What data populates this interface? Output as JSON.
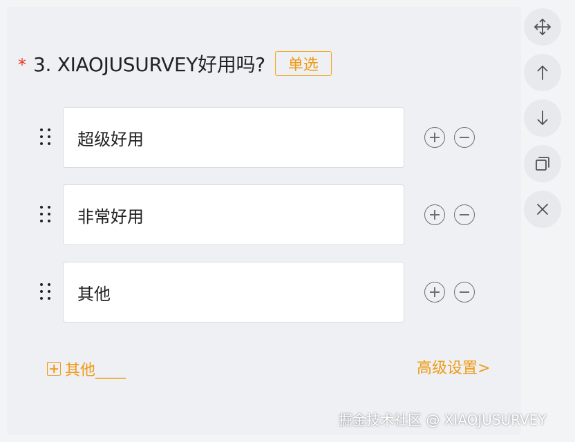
{
  "question": {
    "required_mark": "*",
    "title": "3. XIAOJUSURVEY好用吗?",
    "type_label": "单选"
  },
  "options": [
    {
      "value": "超级好用"
    },
    {
      "value": "非常好用"
    },
    {
      "value": "其他"
    }
  ],
  "footer": {
    "add_other_label": "其他____",
    "advanced_label": "高级设置>"
  },
  "toolbar": {
    "buttons": [
      "move-icon",
      "arrow-up-icon",
      "arrow-down-icon",
      "copy-icon",
      "close-icon"
    ]
  },
  "watermark": "掘金技术社区 @ XIAOJUSURVEY",
  "colors": {
    "accent": "#f09a14",
    "required": "#ea3b2a",
    "icon": "#6b6e73",
    "background": "#eef0f3"
  }
}
